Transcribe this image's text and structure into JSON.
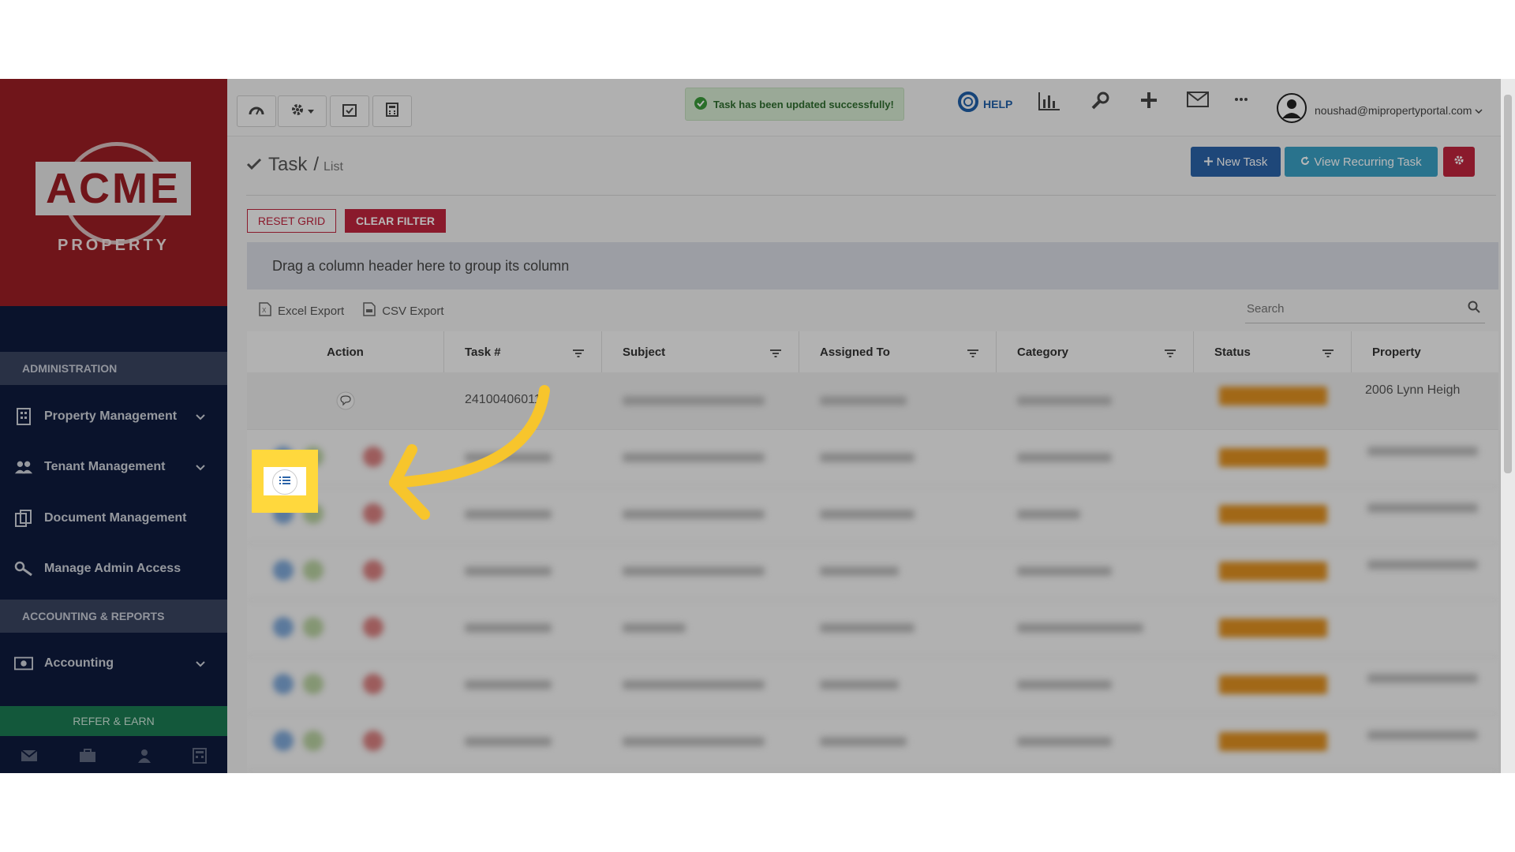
{
  "sidebar": {
    "logo_text": "ACME",
    "logo_sub": "PROPERTY",
    "sections": [
      "ADMINISTRATION",
      "ACCOUNTING & REPORTS"
    ],
    "items": [
      {
        "label": "Property Management",
        "icon": "building-icon"
      },
      {
        "label": "Tenant Management",
        "icon": "users-icon"
      },
      {
        "label": "Document Management",
        "icon": "documents-icon"
      },
      {
        "label": "Manage Admin Access",
        "icon": "key-icon"
      },
      {
        "label": "Accounting",
        "icon": "money-icon"
      }
    ],
    "refer_label": "REFER & EARN"
  },
  "topbar": {
    "toast": "Task has been updated successfully!",
    "help_label": "HELP",
    "user_email": "noushad@mipropertyportal.com"
  },
  "page": {
    "title": "Task",
    "crumb": "List",
    "new_task": "New Task",
    "view_recurring": "View Recurring Task",
    "reset_grid": "RESET GRID",
    "clear_filter": "CLEAR FILTER",
    "group_hint": "Drag a column header here to group its column",
    "excel_export": "Excel Export",
    "csv_export": "CSV Export",
    "search_placeholder": "Search"
  },
  "grid": {
    "columns": [
      "Action",
      "Task #",
      "Subject",
      "Assigned To",
      "Category",
      "Status",
      "Property"
    ],
    "first_row": {
      "task_no": "241004060116",
      "property": "2006 Lynn Heigh"
    }
  },
  "colors": {
    "brand_red": "#9b1e24",
    "sidebar_navy": "#0f1b3d",
    "primary_blue": "#2a63a8",
    "teal": "#3aa0c4",
    "danger": "#c0243e",
    "highlight_yellow": "#ffd83d",
    "status_orange": "#e09020"
  }
}
